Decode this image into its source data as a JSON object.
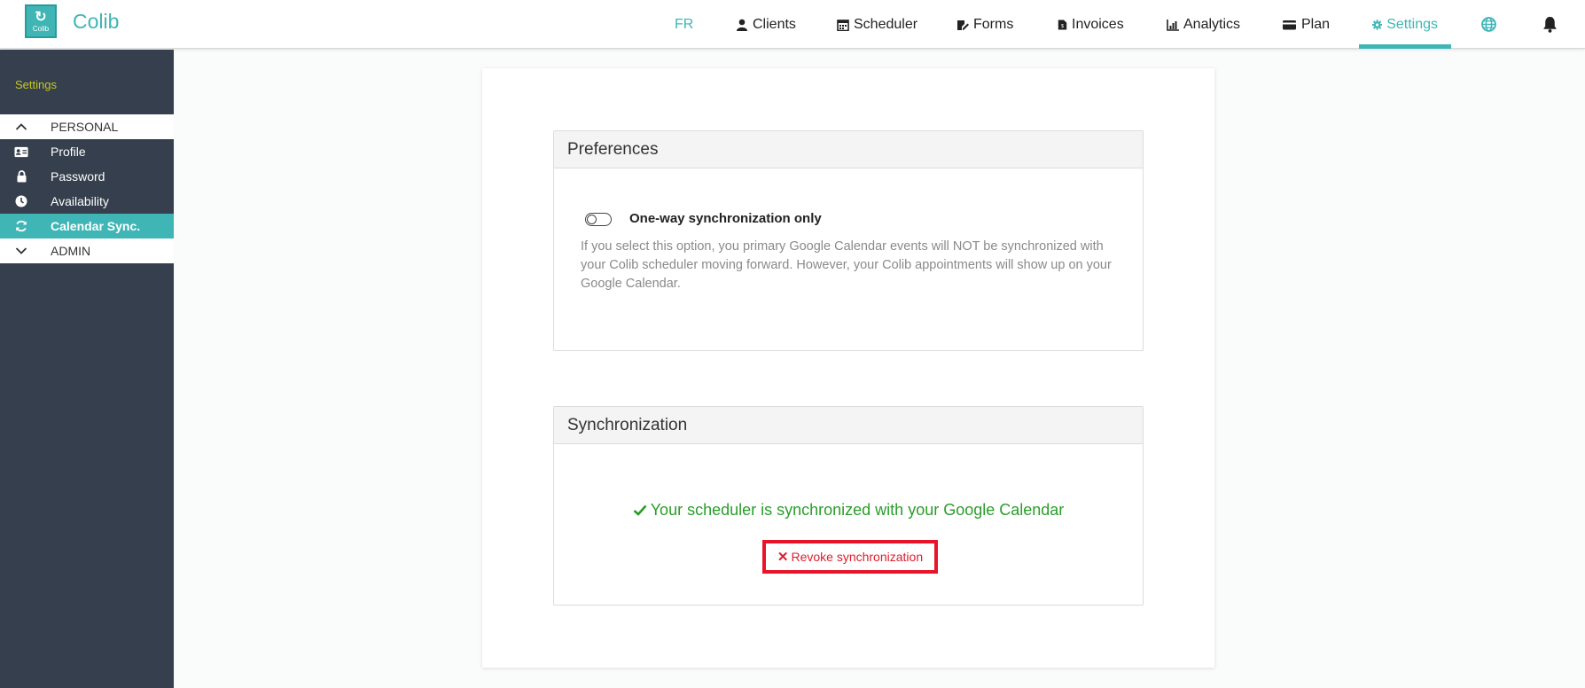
{
  "app": {
    "logo_text": "Colib",
    "brand": "Colib"
  },
  "topnav": {
    "lang": "FR",
    "items": [
      {
        "label": "Clients",
        "icon": "user-icon"
      },
      {
        "label": "Scheduler",
        "icon": "calendar-icon"
      },
      {
        "label": "Forms",
        "icon": "form-edit-icon"
      },
      {
        "label": "Invoices",
        "icon": "invoice-icon"
      },
      {
        "label": "Analytics",
        "icon": "chart-icon"
      },
      {
        "label": "Plan",
        "icon": "credit-card-icon"
      },
      {
        "label": "Settings",
        "icon": "gear-icon"
      }
    ],
    "active": "Settings",
    "accent_color": "#3fb5b5"
  },
  "sidebar": {
    "title": "Settings",
    "groups": [
      {
        "label": "PERSONAL",
        "icon": "chevron-up-icon"
      },
      {
        "label": "ADMIN",
        "icon": "chevron-down-icon"
      }
    ],
    "items": [
      {
        "label": "Profile",
        "icon": "id-card-icon"
      },
      {
        "label": "Password",
        "icon": "lock-icon"
      },
      {
        "label": "Availability",
        "icon": "clock-icon"
      },
      {
        "label": "Calendar Sync.",
        "icon": "sync-icon"
      }
    ],
    "active": "Calendar Sync."
  },
  "preferences": {
    "title": "Preferences",
    "option_label": "One-way synchronization only",
    "option_enabled": false,
    "option_description": "If you select this option, you primary Google Calendar events will NOT be synchronized with your Colib scheduler moving forward. However, your Colib appointments will show up on your Google Calendar."
  },
  "synchronization": {
    "title": "Synchronization",
    "status": "Your scheduler is synchronized with your Google Calendar",
    "status_color": "#2a9d2a",
    "revoke_label": "Revoke synchronization",
    "revoke_color": "#d9202e"
  }
}
